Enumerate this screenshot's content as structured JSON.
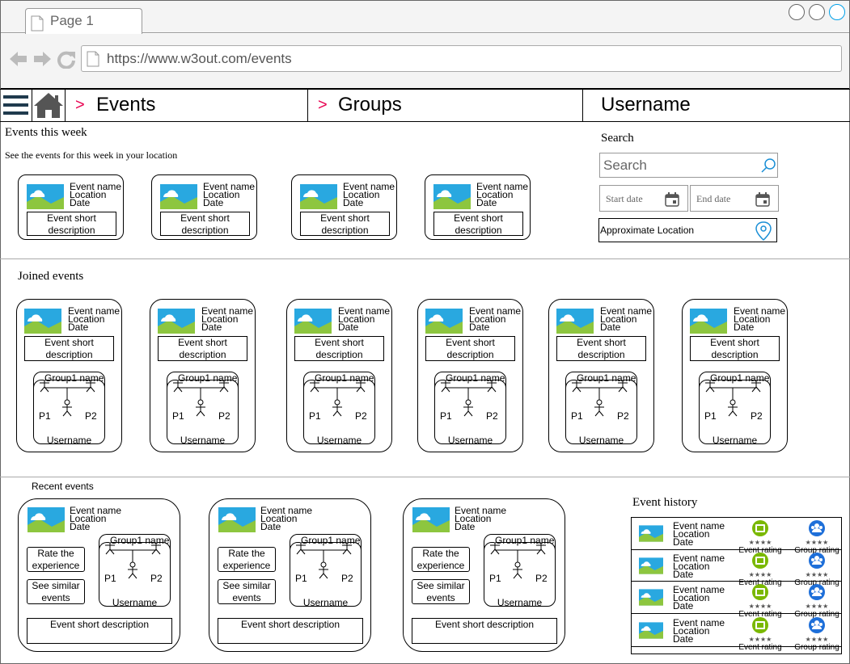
{
  "browser": {
    "tab_title": "Page 1",
    "url": "https://www.w3out.com/events"
  },
  "nav": {
    "events": "Events",
    "groups": "Groups",
    "username": "Username",
    "separator": ">"
  },
  "this_week": {
    "title": "Events this week",
    "subtitle": "See the events for this week in your location",
    "cards": [
      {
        "name": "Event name",
        "location": "Location",
        "date": "Date",
        "desc": "Event short description"
      },
      {
        "name": "Event name",
        "location": "Location",
        "date": "Date",
        "desc": "Event short description"
      },
      {
        "name": "Event name",
        "location": "Location",
        "date": "Date",
        "desc": "Event short description"
      },
      {
        "name": "Event name",
        "location": "Location",
        "date": "Date",
        "desc": "Event short description"
      }
    ]
  },
  "search": {
    "title": "Search",
    "placeholder": "Search",
    "start_date": "Start date",
    "end_date": "End date",
    "location": "Approximate Location"
  },
  "joined": {
    "title": "Joined events",
    "cards": [
      {
        "name": "Event name",
        "location": "Location",
        "date": "Date",
        "desc": "Event short description",
        "group": "Group1 name",
        "p1": "P1",
        "p2": "P2",
        "user": "Username"
      },
      {
        "name": "Event name",
        "location": "Location",
        "date": "Date",
        "desc": "Event short description",
        "group": "Group1 name",
        "p1": "P1",
        "p2": "P2",
        "user": "Username"
      },
      {
        "name": "Event name",
        "location": "Location",
        "date": "Date",
        "desc": "Event short description",
        "group": "Group1 name",
        "p1": "P1",
        "p2": "P2",
        "user": "Username"
      },
      {
        "name": "Event name",
        "location": "Location",
        "date": "Date",
        "desc": "Event short description",
        "group": "Group1 name",
        "p1": "P1",
        "p2": "P2",
        "user": "Username"
      },
      {
        "name": "Event name",
        "location": "Location",
        "date": "Date",
        "desc": "Event short description",
        "group": "Group1 name",
        "p1": "P1",
        "p2": "P2",
        "user": "Username"
      },
      {
        "name": "Event name",
        "location": "Location",
        "date": "Date",
        "desc": "Event short description",
        "group": "Group1 name",
        "p1": "P1",
        "p2": "P2",
        "user": "Username"
      }
    ]
  },
  "recent": {
    "title": "Recent events",
    "cards": [
      {
        "name": "Event name",
        "location": "Location",
        "date": "Date",
        "rate": "Rate the experience",
        "similar": "See similar events",
        "desc": "Event short description",
        "group": "Group1 name",
        "p1": "P1",
        "p2": "P2",
        "user": "Username"
      },
      {
        "name": "Event name",
        "location": "Location",
        "date": "Date",
        "rate": "Rate the experience",
        "similar": "See similar events",
        "desc": "Event short description",
        "group": "Group1 name",
        "p1": "P1",
        "p2": "P2",
        "user": "Username"
      },
      {
        "name": "Event name",
        "location": "Location",
        "date": "Date",
        "rate": "Rate the experience",
        "similar": "See similar events",
        "desc": "Event short description",
        "group": "Group1 name",
        "p1": "P1",
        "p2": "P2",
        "user": "Username"
      }
    ]
  },
  "history": {
    "title": "Event history",
    "rows": [
      {
        "name": "Event name",
        "location": "Location",
        "date": "Date",
        "event_rating": "Event rating",
        "group_rating": "Group rating"
      },
      {
        "name": "Event name",
        "location": "Location",
        "date": "Date",
        "event_rating": "Event rating",
        "group_rating": "Group rating"
      },
      {
        "name": "Event name",
        "location": "Location",
        "date": "Date",
        "event_rating": "Event rating",
        "group_rating": "Group rating"
      },
      {
        "name": "Event name",
        "location": "Location",
        "date": "Date",
        "event_rating": "Event rating",
        "group_rating": "Group rating"
      }
    ]
  },
  "colors": {
    "accent_red": "#e8004f",
    "nav_icon": "#1f3a4d",
    "image_sky": "#29a8e0",
    "image_grass": "#8dc63f",
    "rating_green": "#7ab800",
    "rating_blue": "#1e6fd9",
    "window_btn_active": "#00a0e8"
  }
}
